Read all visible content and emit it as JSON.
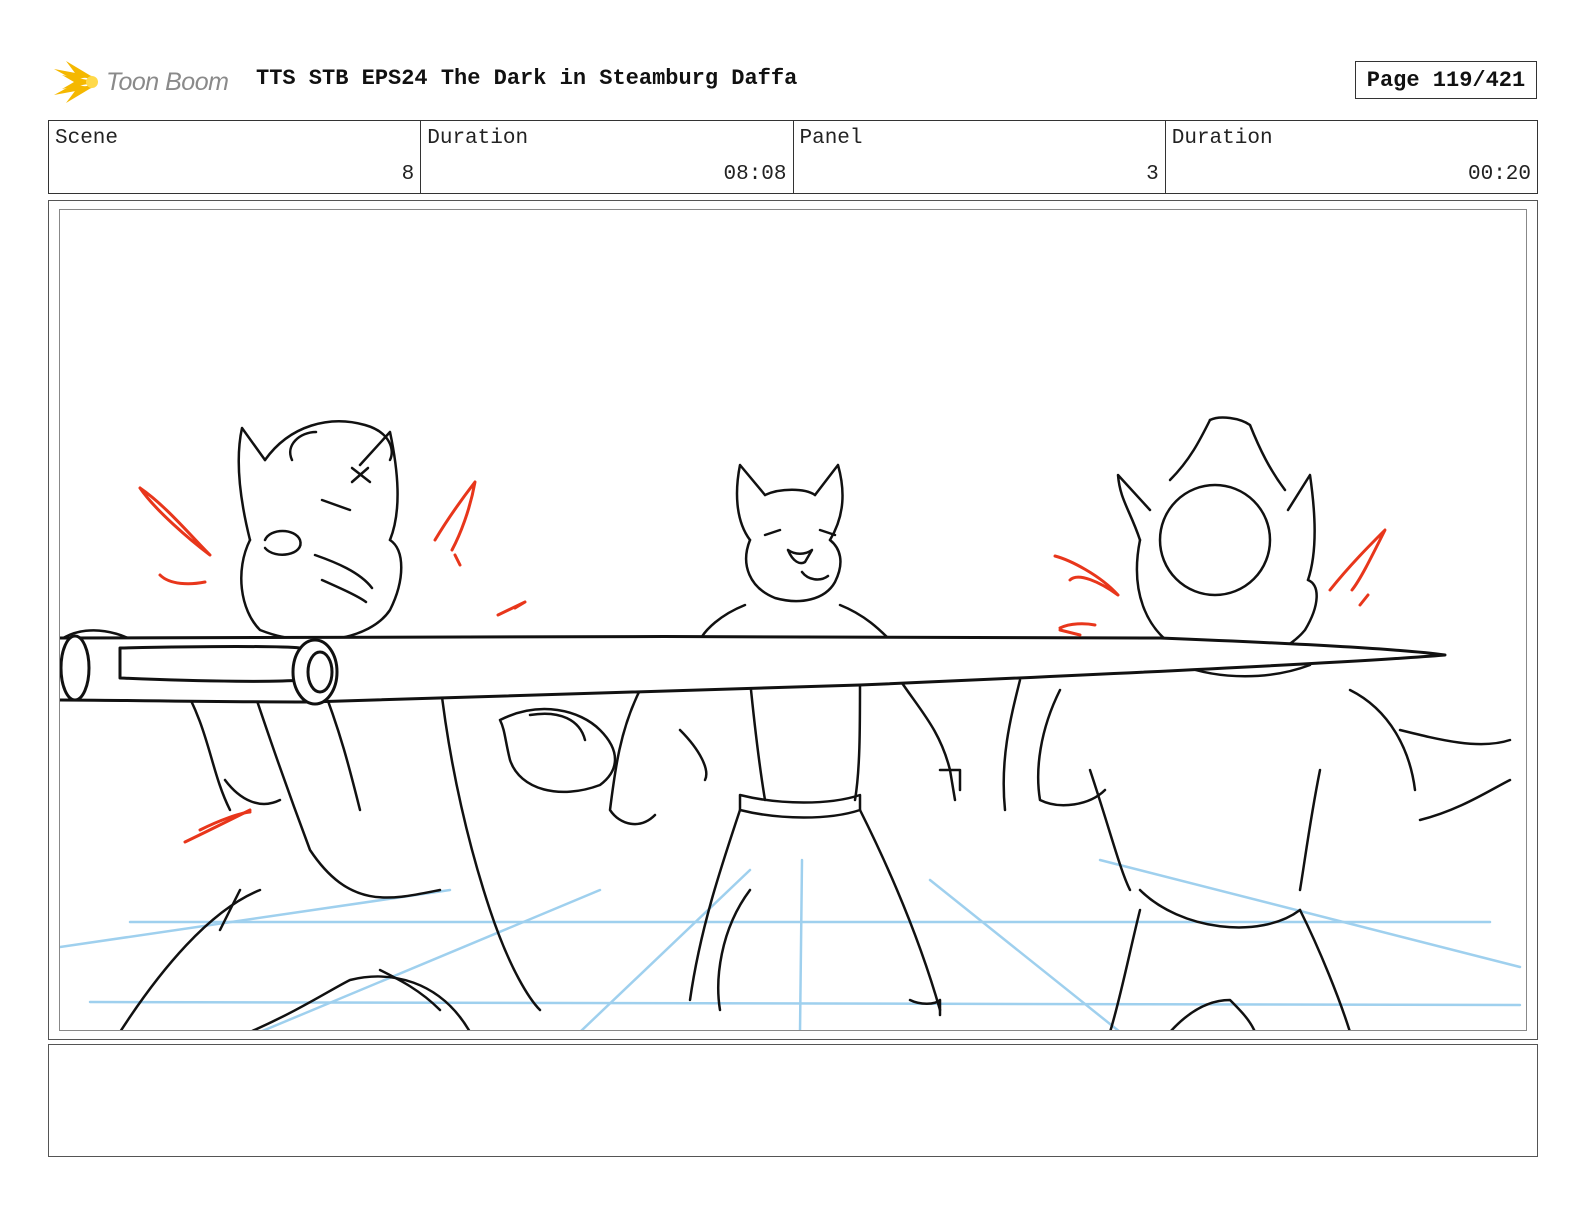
{
  "header": {
    "logo_text": "Toon Boom",
    "title": "TTS STB EPS24 The Dark in Steamburg Daffa",
    "page_label": "Page 119/421"
  },
  "info": {
    "scene_label": "Scene",
    "scene_value": "8",
    "scene_duration_label": "Duration",
    "scene_duration_value": "08:08",
    "panel_label": "Panel",
    "panel_value": "3",
    "panel_duration_label": "Duration",
    "panel_duration_value": "00:20"
  },
  "colors": {
    "ink": "#111111",
    "perspective_guides": "#9fd0ee",
    "action_marks": "#e8361b",
    "logo_flare": "#f5b800"
  }
}
